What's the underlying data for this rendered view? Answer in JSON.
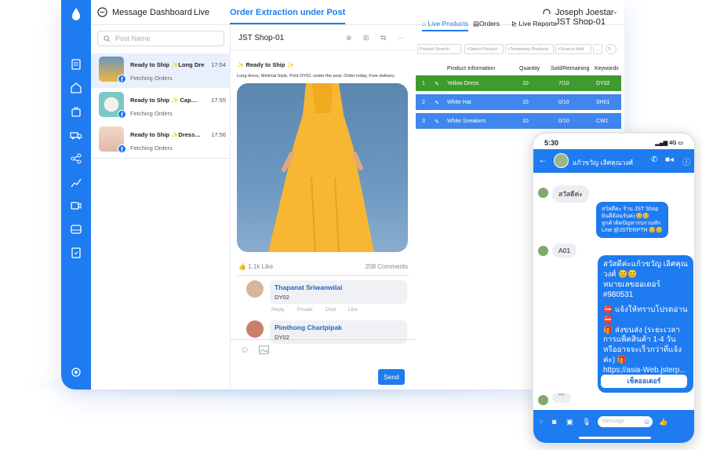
{
  "topnav": {
    "message": "Message",
    "dashboard": "Dashboard",
    "live": "Live",
    "order_extraction": "Order Extraction under Post",
    "account": "Joseph Joestar-JST Shop-01",
    "accent": "#1e7bf0"
  },
  "postlist": {
    "search_placeholder": "Post Name",
    "items": [
      {
        "title": "Ready to Ship ✨Long Dress…",
        "time": "17:54",
        "status": "Fetching Orders"
      },
      {
        "title": "Ready to Ship ✨ Cap…",
        "time": "17:55",
        "status": "Fetching Orders"
      },
      {
        "title": "Ready to Ship ✨Dress…",
        "time": "17:56",
        "status": "Fetching Orders"
      }
    ]
  },
  "post": {
    "shop": "JST Shop-01",
    "ready": "Ready to Ship",
    "description": "Long dress, Minimal Style, Print DY02, under the post, Order today, Free delivery",
    "likes": "1.1k Like",
    "comments_count": "208 Comments",
    "comments": [
      {
        "name": "Thapanat Sriwanwilai",
        "text": "DY02",
        "reply": "Reply",
        "private": "Private Chat",
        "like": "Like"
      },
      {
        "name": "Pimthong Chartpipak",
        "text": "DY02"
      }
    ],
    "send": "Send"
  },
  "live": {
    "tabs": [
      "Live Products",
      "Orders",
      "Live Reports"
    ],
    "filters": [
      "Product Search",
      "+Select Product",
      "+Temporary Products",
      "+Scan to Add",
      "…"
    ],
    "headers": [
      "Product Information",
      "Quantity",
      "Sold/Remaining",
      "Keywords"
    ],
    "rows": [
      {
        "no": "1",
        "name": "Yellow Dress",
        "qty": "10",
        "sold": "7/10",
        "kw": "DY02",
        "color": "#3f9b2f"
      },
      {
        "no": "2",
        "name": "White Hat",
        "qty": "10",
        "sold": "0/10",
        "kw": "SH01",
        "color": "#3f86ee"
      },
      {
        "no": "3",
        "name": "White Sneakers",
        "qty": "10",
        "sold": "0/10",
        "kw": "CW1",
        "color": "#3f86ee"
      }
    ]
  },
  "phone": {
    "time": "5:30",
    "signal": "4G",
    "contact": "แก้วขวัญ เลิศคุณวงศ์",
    "msg1": "สวัสดีค่ะ",
    "out1": "สวัสดีค่ะ ร้าน JST Shop ยินดีต้อนรับค่ะ😊😊 ลูกค้าติดปัญหารบกวนทัก Line @JSTERPTH 😊😊",
    "msg2": "A01",
    "big": [
      "สวัสดีค่ะแก้วขวัญ เลิศคุณวงศ์ 😊😊",
      "หมายเลขออเดอร์ #980531",
      "⛔ แจ้งให้ทราบโปรดอ่าน ⛔",
      "🎁 ส่งขนส่ง (ระยะเวลาการแพ็คสินค้า 1-4 วันหรืออาจจะเร็วกว่าที่แจ้งค่ะ) 🎁",
      "https://asia-Web.jsterp..."
    ],
    "check_button": "เช็คออเดอร์",
    "input_placeholder": "Message"
  }
}
